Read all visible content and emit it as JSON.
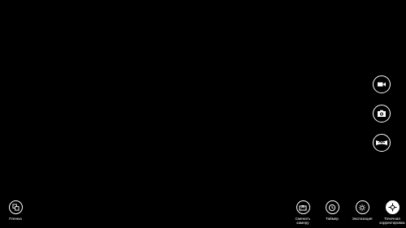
{
  "app": {
    "background": "#000000"
  },
  "bottom_left": {
    "camera_roll": {
      "label": "Пленка",
      "icon": "camera-roll-icon"
    }
  },
  "bottom_right": {
    "switch_camera": {
      "label": "Сменить\nкамеру",
      "icon": "switch-camera-icon"
    },
    "timer": {
      "label": "Таймер",
      "icon": "timer-icon"
    },
    "exposure": {
      "label": "Экспозиция",
      "icon": "exposure-icon"
    },
    "focus": {
      "label": "Точечная\nкорректировка",
      "icon": "focus-icon"
    }
  },
  "side": {
    "video": {
      "icon": "video-camera-icon"
    },
    "photo": {
      "icon": "photo-camera-icon"
    },
    "panorama": {
      "icon": "panorama-icon"
    }
  }
}
